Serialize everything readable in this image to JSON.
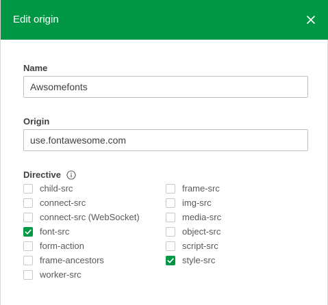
{
  "dialog": {
    "title": "Edit origin",
    "header_color": "#009845",
    "close_icon": "close-icon"
  },
  "name_field": {
    "label": "Name",
    "value": "Awsomefonts"
  },
  "origin_field": {
    "label": "Origin",
    "value": "use.fontawesome.com"
  },
  "directive": {
    "label": "Directive",
    "info_icon": "info-icon",
    "left_column": [
      {
        "label": "child-src",
        "checked": false
      },
      {
        "label": "connect-src",
        "checked": false
      },
      {
        "label": "connect-src (WebSocket)",
        "checked": false
      },
      {
        "label": "font-src",
        "checked": true
      },
      {
        "label": "form-action",
        "checked": false
      },
      {
        "label": "frame-ancestors",
        "checked": false
      },
      {
        "label": "worker-src",
        "checked": false
      }
    ],
    "right_column": [
      {
        "label": "frame-src",
        "checked": false
      },
      {
        "label": "img-src",
        "checked": false
      },
      {
        "label": "media-src",
        "checked": false
      },
      {
        "label": "object-src",
        "checked": false
      },
      {
        "label": "script-src",
        "checked": false
      },
      {
        "label": "style-src",
        "checked": true
      }
    ]
  }
}
